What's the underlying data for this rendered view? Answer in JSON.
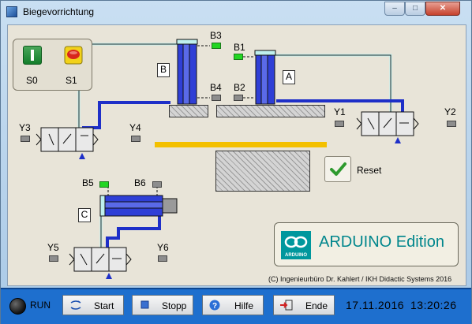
{
  "window": {
    "title": "Biegevorrichtung",
    "buttons": {
      "minimize": "–",
      "maximize": "□",
      "close": "✕"
    }
  },
  "panel": {
    "switches": {
      "s0_label": "S0",
      "s1_label": "S1"
    },
    "cylinders": {
      "a_label": "A",
      "b_label": "B",
      "c_label": "C"
    },
    "sensors": {
      "B1": {
        "label": "B1",
        "active": true
      },
      "B2": {
        "label": "B2",
        "active": false
      },
      "B3": {
        "label": "B3",
        "active": true
      },
      "B4": {
        "label": "B4",
        "active": false
      },
      "B5": {
        "label": "B5",
        "active": true
      },
      "B6": {
        "label": "B6",
        "active": false
      }
    },
    "valves": {
      "Y1": {
        "label": "Y1",
        "active": false
      },
      "Y2": {
        "label": "Y2",
        "active": false
      },
      "Y3": {
        "label": "Y3",
        "active": false
      },
      "Y4": {
        "label": "Y4",
        "active": false
      },
      "Y5": {
        "label": "Y5",
        "active": false
      },
      "Y6": {
        "label": "Y6",
        "active": false
      }
    },
    "reset_label": "Reset",
    "brand": "ARDUINO Edition",
    "brand_logo_text": "ARDUINO",
    "copyright": "(C) Ingenieurbüro Dr. Kahlert / IKH Didactic Systems 2016"
  },
  "statusbar": {
    "run_label": "RUN",
    "buttons": {
      "start": "Start",
      "stop": "Stopp",
      "help": "Hilfe",
      "end": "Ende"
    },
    "date": "17.11.2016",
    "time": "13:20:26"
  },
  "colors": {
    "accent": "#1e6fce",
    "cylinder": "#2f3fd6",
    "pipe_pressure": "#1e2fc8",
    "pipe_exhaust": "#bff0ee",
    "sensor_on": "#22d622",
    "bar": "#f3c000"
  }
}
